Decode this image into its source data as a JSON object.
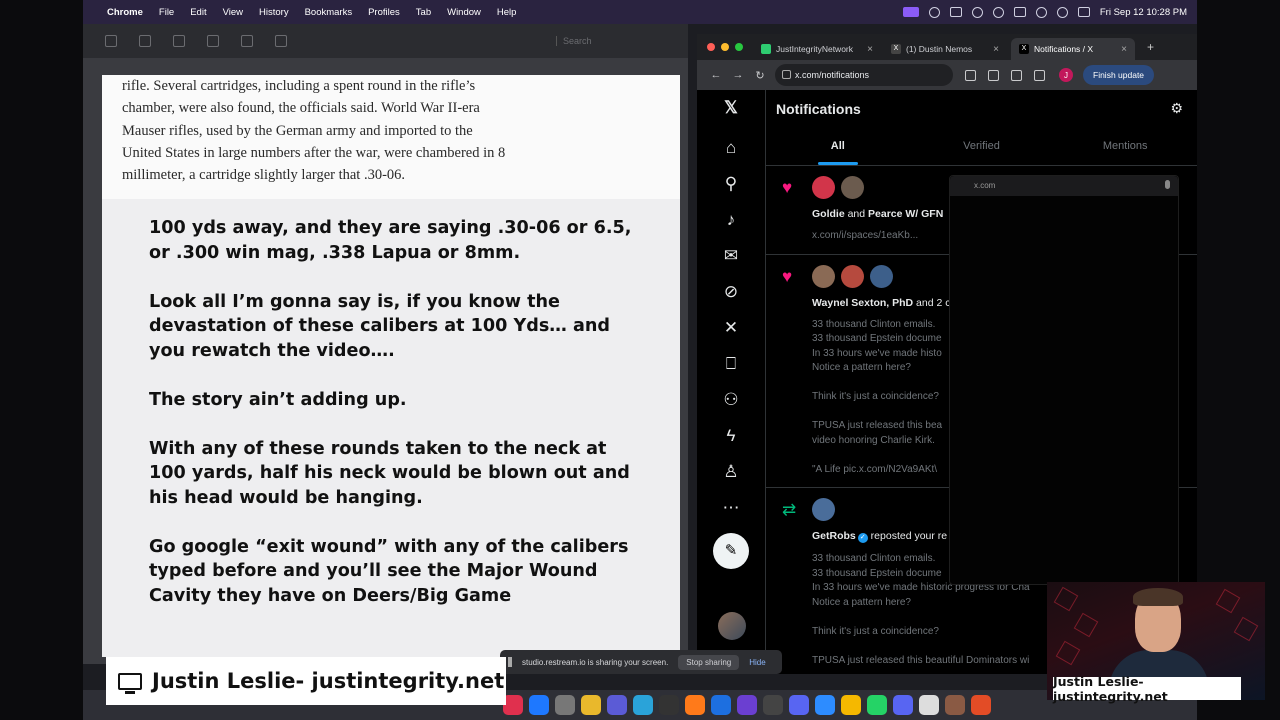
{
  "menubar": {
    "app_name": "Chrome",
    "items": [
      "File",
      "Edit",
      "View",
      "History",
      "Bookmarks",
      "Profiles",
      "Tab",
      "Window",
      "Help"
    ],
    "clock": "Fri Sep 12  10:28 PM"
  },
  "doc": {
    "search_placeholder": "Search",
    "article_lines": [
      "rifle. Several cartridges, including a spent round in the rifle’s",
      "chamber, were also found, the officials said. World War II-era",
      "Mauser rifles, used by the German army and imported to the",
      "United States in large numbers after the war, were chambered in 8",
      "millimeter, a cartridge slightly larger that .30-06."
    ],
    "post_paragraphs": [
      "100 yds away, and they are saying .30-06 or 6.5, or .300 win mag, .338 Lapua or 8mm.",
      "Look all I’m gonna say is, if you know the devastation of these calibers at 100 Yds… and you rewatch the video….",
      "The story ain’t adding up.",
      "With any of these rounds taken to the neck at 100 yards, half his neck would be blown out and his head would be hanging.",
      "Go google “exit wound” with any of the calibers typed before and you’ll see the Major Wound Cavity they have on Deers/Big Game"
    ]
  },
  "browser": {
    "tabs": [
      {
        "label": "JustIntegrityNetwork",
        "active": false
      },
      {
        "label": "(1) Dustin Nemos",
        "active": false
      },
      {
        "label": "Notifications / X",
        "active": true
      }
    ],
    "url": "x.com/notifications",
    "profile_initial": "J",
    "finish_update": "Finish update"
  },
  "x": {
    "title": "Notifications",
    "tabs": [
      "All",
      "Verified",
      "Mentions"
    ],
    "notifications": [
      {
        "kind": "like",
        "title_bold": "Goldie",
        "title_rest": " and ",
        "title_bold2": "Pearce W/ GFN",
        "body": [
          "x.com/i/spaces/1eaKb..."
        ],
        "avatars": [
          "#d2354a",
          "#6b5b4e"
        ]
      },
      {
        "kind": "like",
        "title_bold": "Waynel Sexton, PhD",
        "title_rest": " and 2 c",
        "body": [
          "33 thousand Clinton emails.",
          "33 thousand Epstein docume",
          "In 33 hours we've made histo",
          "Notice a pattern here?",
          "",
          "Think it's just a coincidence?",
          "",
          "TPUSA just released this bea",
          "video honoring Charlie Kirk.",
          "",
          "\"A Life pic.x.com/N2Va9AKt\\"
        ],
        "avatars": [
          "#8a6a55",
          "#b64a3e",
          "#3d5f8a"
        ]
      },
      {
        "kind": "repost",
        "title_bold": "GetRobs",
        "title_rest": " reposted your re",
        "body": [
          "33 thousand Clinton emails.",
          "33 thousand Epstein docume",
          "In 33 hours we've made historic progress for Cha",
          "Notice a pattern here?",
          "",
          "Think it's just a coincidence?",
          "",
          "TPUSA just released this beautiful Dominators wi"
        ],
        "avatars": [
          "#4a6d9a"
        ]
      }
    ],
    "popup_url": "x.com"
  },
  "share_bar": {
    "text": "studio.restream.io is sharing your screen.",
    "stop": "Stop sharing",
    "hide": "Hide"
  },
  "overlay": {
    "lower_third": "Justin Leslie- justintegrity.net",
    "nametag": "Justin Leslie- justintegrity.net"
  },
  "colors": {
    "like": "#f91880",
    "repost": "#00ba7c",
    "x_accent": "#1d9bf0",
    "menubar": "#2a2340"
  }
}
